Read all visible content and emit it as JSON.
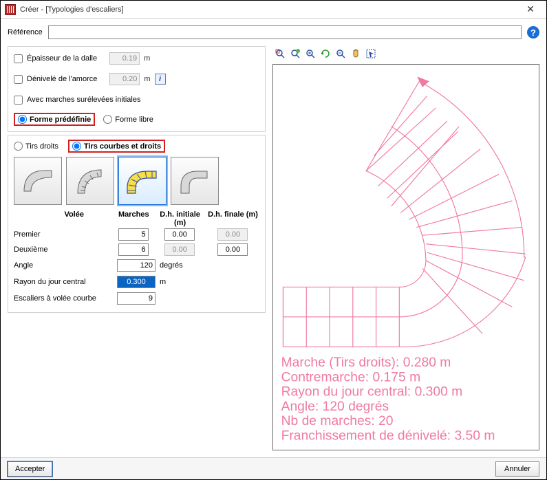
{
  "window": {
    "title": "Créer - [Typologies d'escaliers]",
    "close_glyph": "✕"
  },
  "reference": {
    "label": "Référence",
    "value": "",
    "help_glyph": "?"
  },
  "options": {
    "slab_thickness": {
      "label": "Épaisseur de la dalle",
      "value": "0.19",
      "unit": "m",
      "checked": false
    },
    "start_offset": {
      "label": "Dénivelé de l'amorce",
      "value": "0.20",
      "unit": "m",
      "checked": false,
      "info_glyph": "i"
    },
    "raised_initial": {
      "label": "Avec marches surélevées initiales",
      "checked": false
    }
  },
  "form_radio": {
    "predef": "Forme prédéfinie",
    "free": "Forme libre",
    "selected": "predef"
  },
  "flight_radio": {
    "straight": "Tirs droits",
    "curved": "Tirs courbes et droits",
    "selected": "curved"
  },
  "thumbs": [
    "thumb-1",
    "thumb-2",
    "thumb-3",
    "thumb-4"
  ],
  "selected_thumb_index": 2,
  "table": {
    "headers": {
      "volee": "Volée",
      "marches": "Marches",
      "dh_init": "D.h. initiale (m)",
      "dh_final": "D.h. finale (m)"
    },
    "rows": [
      {
        "label": "Premier",
        "marches": "5",
        "dh_init": "0.00",
        "dh_final": "0.00",
        "dh_final_disabled": true
      },
      {
        "label": "Deuxième",
        "marches": "6",
        "dh_init": "0.00",
        "dh_final": "0.00",
        "dh_init_disabled": true
      }
    ],
    "angle": {
      "label": "Angle",
      "value": "120",
      "unit": "degrés"
    },
    "radius": {
      "label": "Rayon du jour central",
      "value": "0.300",
      "unit": "m",
      "selected": true
    },
    "curved_steps": {
      "label": "Escaliers à volée courbe",
      "value": "9"
    }
  },
  "preview_info": {
    "lines": [
      "Marche (Tirs droits): 0.280 m",
      "Contremarche: 0.175 m",
      "Rayon du jour central: 0.300 m",
      "Angle: 120 degrés",
      "Nb de marches: 20",
      "Franchissement de dénivelé: 3.50 m"
    ]
  },
  "toolbar": {
    "names": [
      "zoom-window-icon",
      "zoom-extents-icon",
      "zoom-in-icon",
      "rotate-icon",
      "zoom-out-icon",
      "pan-icon",
      "select-icon"
    ]
  },
  "footer": {
    "accept": "Accepter",
    "cancel": "Annuler"
  }
}
